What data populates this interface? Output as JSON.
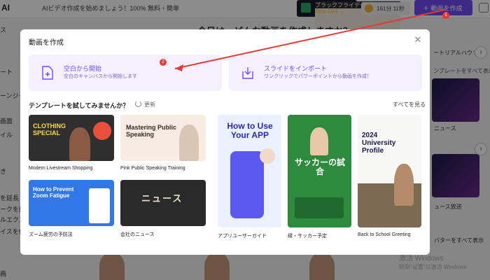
{
  "app": {
    "logo": "AI",
    "promo": "AIビデオ作成を始めましょう！100% 無料・簡単",
    "black_friday_line1": "ブラックフライデー",
    "black_friday_line2": "45% OFF ›",
    "credits": "161分 11秒",
    "create_button": "動画を作成"
  },
  "background": {
    "heading": "今日は、どんな動画を作成しますか？",
    "sidebar": [
      "ス",
      "ート",
      "ーンジャー",
      "画面",
      "イル",
      "き",
      "を延長",
      "ークを削除",
      "ルエクスポー",
      "イスを使用",
      "画"
    ],
    "right_title": "ートリアルハウツー",
    "right_link": "ンプレートをすべて表示",
    "right_caption_1": "ニュース",
    "right_caption_2": "ュース放送",
    "right_link_2": "バターをすべて表示",
    "watermark_1": "激活 Windows",
    "watermark_2": "转到\"设置\"以激活 Windows"
  },
  "modal": {
    "title": "動画を作成",
    "blank_title": "空白から開始",
    "blank_sub": "空白のキャンバスから開始します",
    "slide_title": "スライドをインポート",
    "slide_sub": "ワンクリックでパワーポイントから動画を作成！",
    "templates_heading": "テンプレートを試してみませんか？",
    "refresh": "更新",
    "see_all": "すべてを見る",
    "templates": [
      {
        "caption": "Modern Livestream Shopping",
        "text": "CLOTHING SPECIAL"
      },
      {
        "caption": "Pink Public Speaking Training",
        "text": "Mastering Public Speaking"
      },
      {
        "caption": "ズーム疲労の予防法",
        "text": "How to Prevent Zoom Fatigue"
      },
      {
        "caption": "会社のニュース",
        "text": "ニュース"
      },
      {
        "caption": "アプリユーザーガイド",
        "text": "How to Use Your APP"
      },
      {
        "caption": "緑・サッカー予定",
        "text": "サッカーの試合"
      },
      {
        "caption": "Back to School Greeting",
        "text": "2024 University Profile"
      }
    ]
  },
  "annotations": {
    "one": "1",
    "two": "2"
  },
  "colors": {
    "accent": "#6f4ef6",
    "annotation": "#e53935"
  }
}
